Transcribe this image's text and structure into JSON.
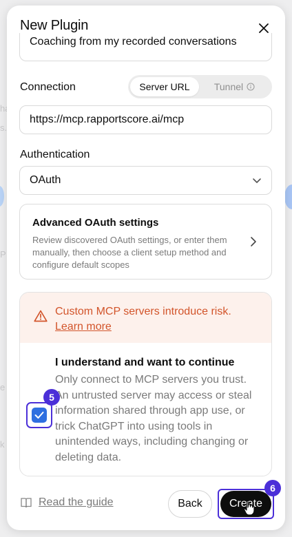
{
  "background": {
    "fragments": [
      "ha",
      "s.",
      "P",
      "e D",
      "k"
    ]
  },
  "modal": {
    "title": "New Plugin",
    "close_icon": "close-icon",
    "description_value": "Coaching from my recorded conversations",
    "connection": {
      "label": "Connection",
      "options": [
        "Server URL",
        "Tunnel"
      ],
      "selected": "Server URL",
      "tunnel_info_icon": "info-icon",
      "url_value": "https://mcp.rapportscore.ai/mcp"
    },
    "authentication": {
      "label": "Authentication",
      "selected": "OAuth",
      "chevron_icon": "chevron-down-icon"
    },
    "advanced": {
      "title": "Advanced OAuth settings",
      "description": "Review discovered OAuth settings, or enter them manually, then choose a client setup method and configure default scopes",
      "chevron_icon": "chevron-right-icon"
    },
    "risk": {
      "warning": "Custom MCP servers introduce risk.",
      "learn_more": "Learn more",
      "warning_icon": "warning-triangle-icon",
      "ack_title": "I understand and want to continue",
      "ack_body": "Only connect to MCP servers you trust. An untrusted server may access or steal information shared through app use, or trick ChatGPT into using tools in unintended ways, including changing or deleting data.",
      "checked": true
    },
    "footer": {
      "guide": "Read the guide",
      "guide_icon": "book-icon",
      "back": "Back",
      "create": "Create"
    }
  },
  "annotations": {
    "checkbox_marker": "5",
    "create_marker": "6"
  },
  "colors": {
    "accent": "#4b2fd8",
    "warning": "#d2542a",
    "checkbox": "#2f6fe0",
    "primary_button": "#0d0d0d"
  }
}
